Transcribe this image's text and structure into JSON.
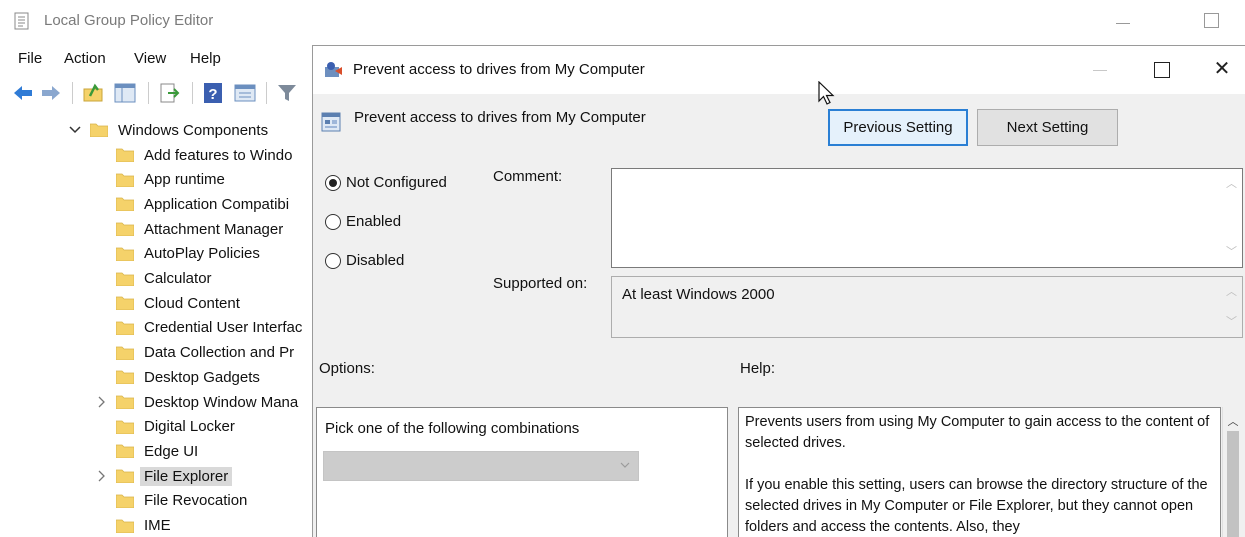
{
  "main_window": {
    "title": "Local Group Policy Editor",
    "menu": [
      "File",
      "Action",
      "View",
      "Help"
    ],
    "toolbar_icons": [
      "back-arrow-icon",
      "forward-arrow-icon",
      "up-folder-icon",
      "show-hide-tree-icon",
      "export-list-icon",
      "help-icon",
      "properties-icon",
      "filter-icon"
    ]
  },
  "tree": {
    "parent": "Windows Components",
    "items": [
      {
        "label": "Add features to Windo",
        "expandable": false
      },
      {
        "label": "App runtime",
        "expandable": false
      },
      {
        "label": "Application Compatibi",
        "expandable": false
      },
      {
        "label": "Attachment Manager",
        "expandable": false
      },
      {
        "label": "AutoPlay Policies",
        "expandable": false
      },
      {
        "label": "Calculator",
        "expandable": false
      },
      {
        "label": "Cloud Content",
        "expandable": false
      },
      {
        "label": "Credential User Interfac",
        "expandable": false
      },
      {
        "label": "Data Collection and Pr",
        "expandable": false
      },
      {
        "label": "Desktop Gadgets",
        "expandable": false
      },
      {
        "label": "Desktop Window Mana",
        "expandable": true
      },
      {
        "label": "Digital Locker",
        "expandable": false
      },
      {
        "label": "Edge UI",
        "expandable": false
      },
      {
        "label": "File Explorer",
        "expandable": true,
        "selected": true
      },
      {
        "label": "File Revocation",
        "expandable": false
      },
      {
        "label": "IME",
        "expandable": false
      }
    ]
  },
  "dialog": {
    "title": "Prevent access to drives from My Computer",
    "setting_name": "Prevent access to drives from My Computer",
    "previous_button": "Previous Setting",
    "next_button": "Next Setting",
    "radios": [
      {
        "label": "Not Configured",
        "checked": true
      },
      {
        "label": "Enabled",
        "checked": false
      },
      {
        "label": "Disabled",
        "checked": false
      }
    ],
    "comment_label": "Comment:",
    "comment_value": "",
    "supported_label": "Supported on:",
    "supported_value": "At least Windows 2000",
    "options_label": "Options:",
    "help_label": "Help:",
    "options_text": "Pick one of the following combinations",
    "combo_value": "",
    "help_paragraphs": [
      "Prevents users from using My Computer to gain access to the content of selected drives.",
      "If you enable this setting, users can browse the directory structure of the selected drives in My Computer or File Explorer, but they cannot open folders and access the contents. Also, they"
    ]
  },
  "colors": {
    "dialog_bg": "#f0f0f0",
    "focus_border": "#2a7fd4",
    "folder_yellow": "#f5d26a",
    "selection_bg": "#d9d9d9"
  }
}
